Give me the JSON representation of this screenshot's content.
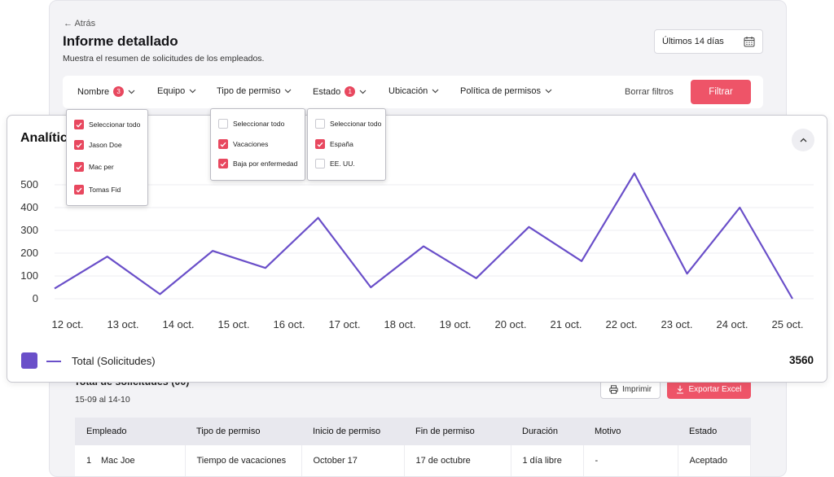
{
  "header": {
    "back": "← Atrás",
    "title": "Informe detallado",
    "subtitle": "Muestra el resumen de solicitudes de los empleados.",
    "date_range": "Últimos 14 días"
  },
  "filters": {
    "nombre": {
      "label": "Nombre",
      "count": "3"
    },
    "equipo": {
      "label": "Equipo"
    },
    "tipo": {
      "label": "Tipo de permiso"
    },
    "estado": {
      "label": "Estado",
      "count": "1"
    },
    "ubicacion": {
      "label": "Ubicación"
    },
    "politica": {
      "label": "Política de permisos"
    },
    "clear": "Borrar filtros",
    "apply": "Filtrar"
  },
  "dropdowns": {
    "nombre": [
      {
        "label": "Seleccionar todo",
        "checked": true
      },
      {
        "label": "Jason Doe",
        "checked": true
      },
      {
        "label": "Mac per",
        "checked": true
      },
      {
        "label": "Tomas Fid",
        "checked": true
      }
    ],
    "tipo": [
      {
        "label": "Seleccionar todo",
        "checked": false
      },
      {
        "label": "Vacaciones",
        "checked": true
      },
      {
        "label": "Baja por enfermedad",
        "checked": true
      }
    ],
    "ubicacion": [
      {
        "label": "Seleccionar todo",
        "checked": false
      },
      {
        "label": "España",
        "checked": true
      },
      {
        "label": "EE. UU.",
        "checked": false
      }
    ]
  },
  "analytics": {
    "title": "Analític",
    "legend_label": "Total (Solicitudes)",
    "total": "3560"
  },
  "chart_data": {
    "type": "line",
    "x": [
      "12 oct.",
      "13 oct.",
      "14 oct.",
      "15 oct.",
      "16 oct.",
      "17 oct.",
      "18 oct.",
      "19 oct.",
      "20 oct.",
      "21 oct.",
      "22 oct.",
      "23 oct.",
      "24 oct.",
      "25 oct."
    ],
    "series": [
      {
        "name": "Total (Solicitudes)",
        "values": [
          45,
          185,
          20,
          210,
          135,
          355,
          50,
          230,
          90,
          315,
          165,
          550,
          110,
          400,
          0
        ]
      }
    ],
    "y_ticks": [
      0,
      100,
      200,
      300,
      400,
      500
    ],
    "ylim": [
      0,
      600
    ],
    "grid": true,
    "color": "#6a4fc9"
  },
  "table": {
    "title": "Total de solicitudes (00)",
    "period": "15-09 al 14-10",
    "print": "Imprimir",
    "export": "Exportar Excel",
    "columns": [
      "Empleado",
      "Tipo de permiso",
      "Inicio de permiso",
      "Fin de permiso",
      "Duración",
      "Motivo",
      "Estado"
    ],
    "rows": [
      {
        "num": "1",
        "cells": [
          "Mac Joe",
          "Tiempo de vacaciones",
          "October 17",
          "17 de octubre",
          "1 día libre",
          "-",
          "Aceptado"
        ]
      }
    ]
  },
  "colors": {
    "accent": "#ee5468",
    "chart": "#6a4fc9"
  }
}
